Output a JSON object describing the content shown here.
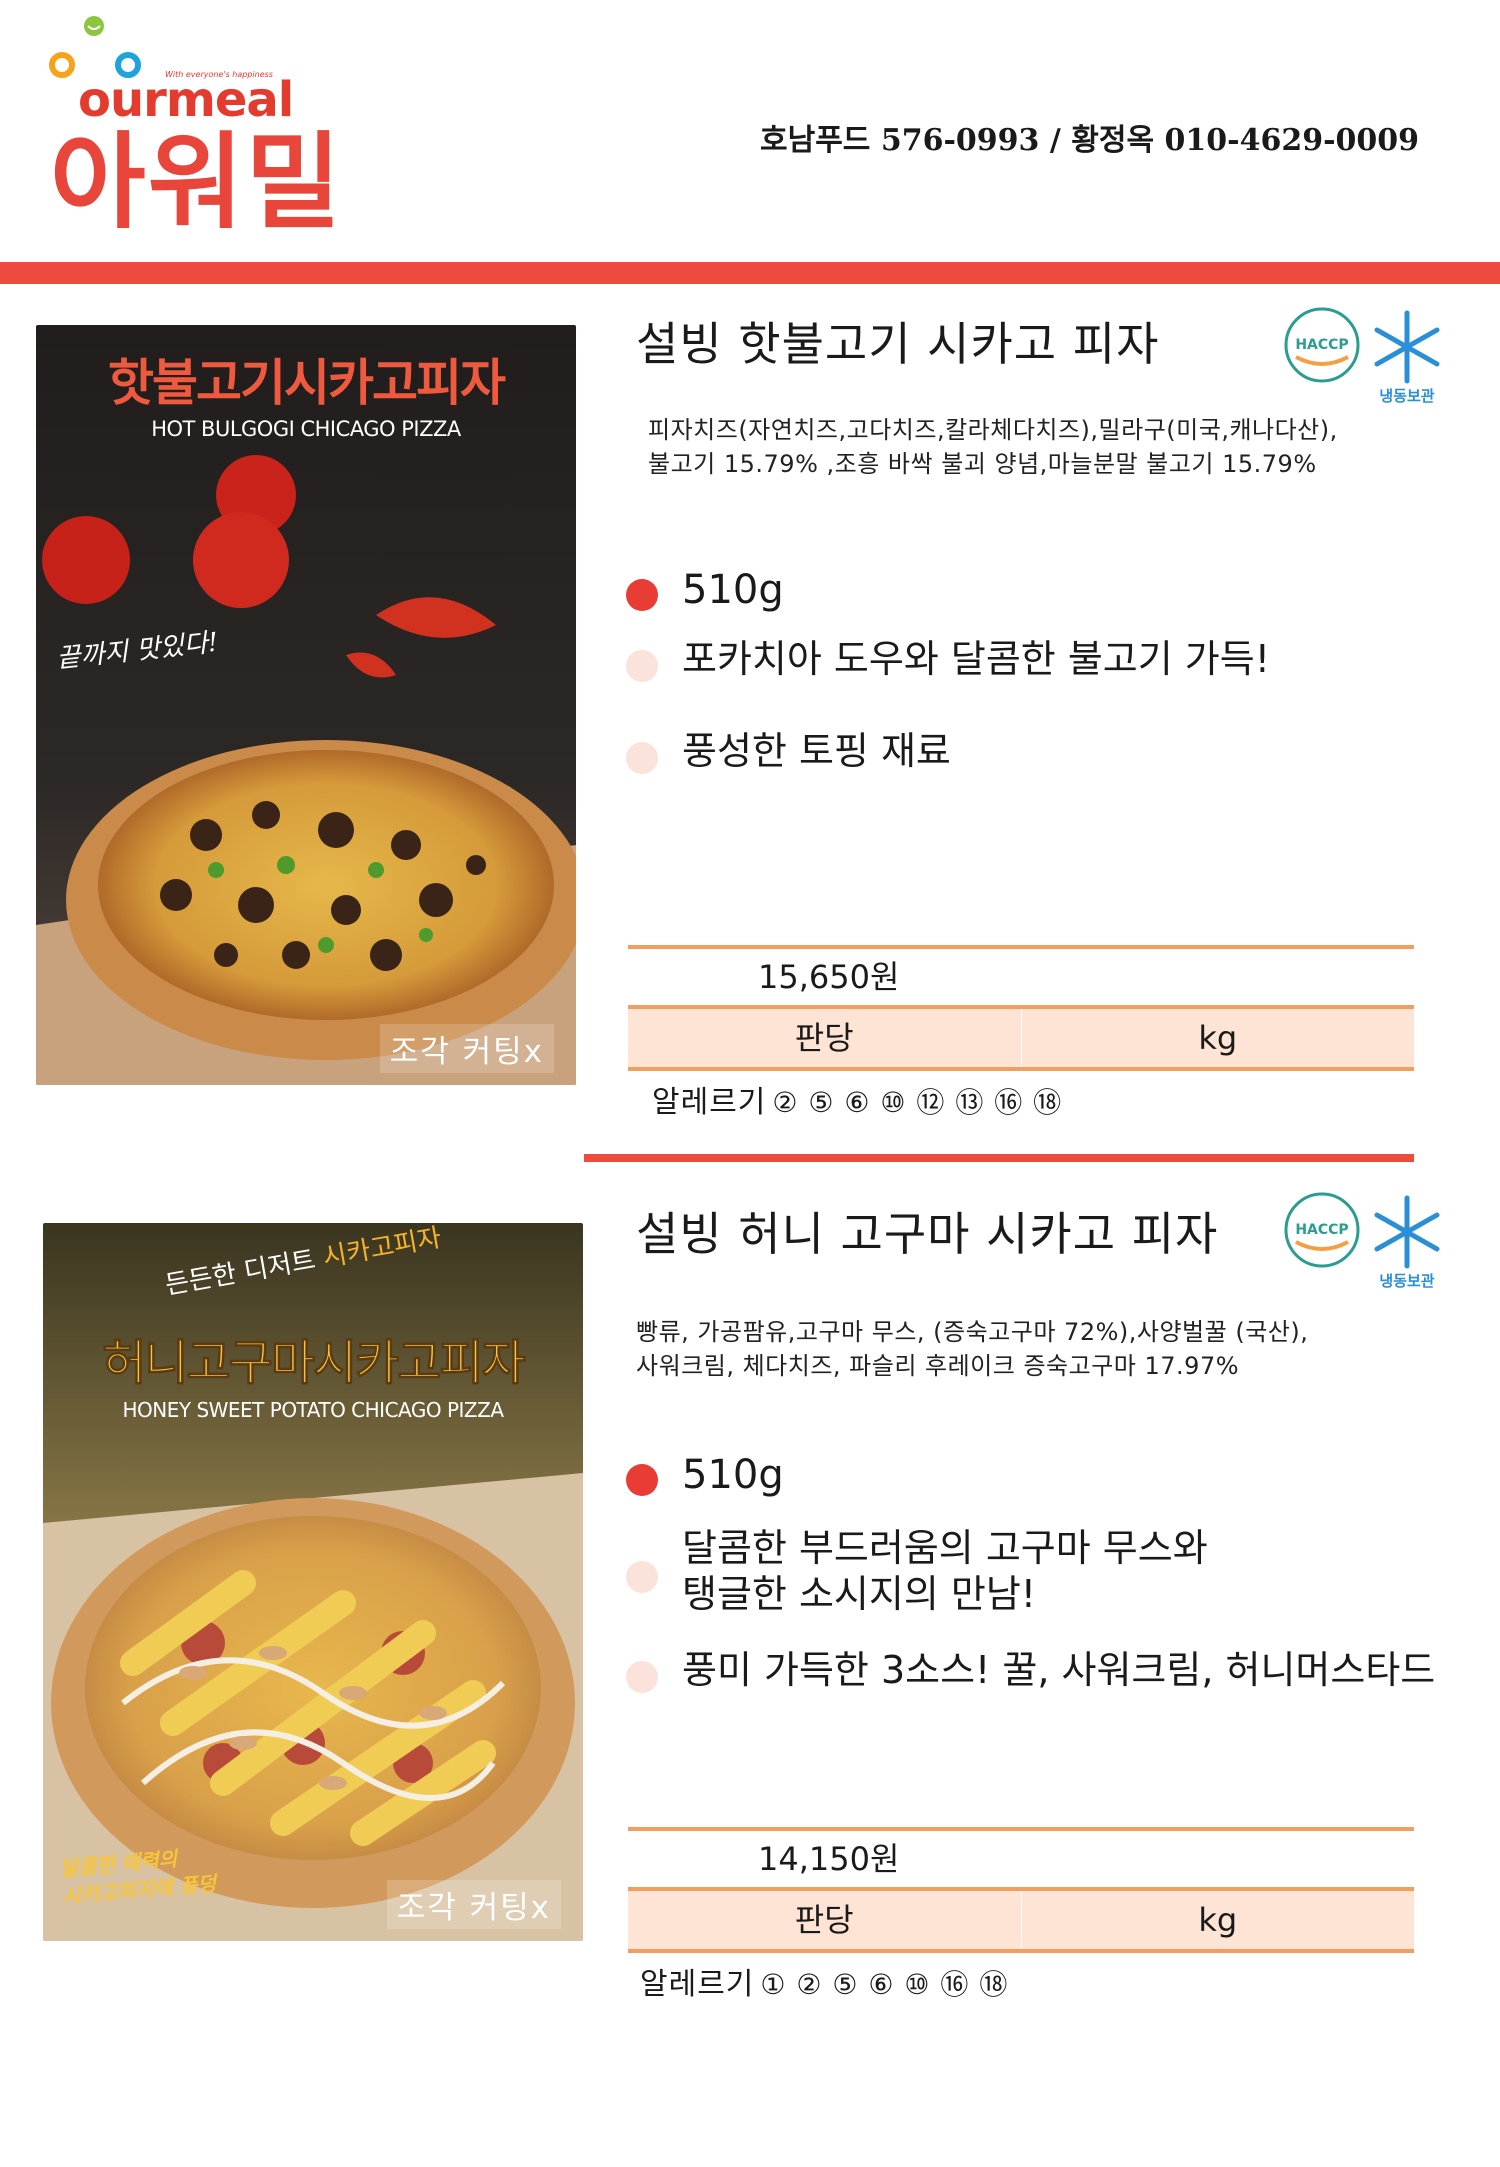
{
  "header": {
    "brand_tagline": "With everyone's happiness",
    "brand_en": "ourmeal",
    "brand_ko": "아워밀",
    "contact": "호남푸드 576-0993 / 황정옥 010-4629-0009",
    "accent_color": "#ee4a3f"
  },
  "badges": {
    "haccp_label": "HACCP",
    "frozen_label": "냉동보관"
  },
  "products": [
    {
      "photo_title": "핫불고기시카고피자",
      "photo_subtitle": "HOT BULGOGI CHICAGO PIZZA",
      "photo_script": "끝까지 맛있다!",
      "cut_label": "조각 커팅x",
      "name": "설빙 핫불고기 시카고 피자",
      "ingredients_line1": "피자치즈(자연치즈,고다치즈,칼라체다치즈),밀라구(미국,캐나다산),",
      "ingredients_line2": "불고기 15.79% ,조흥 바싹 불괴 양념,마늘분말 불고기 15.79%",
      "weight": "510g",
      "points": [
        "포카치아 도우와 달콤한 불고기 가득!",
        "풍성한 토핑 재료"
      ],
      "price": "15,650원",
      "unit_left": "판당",
      "unit_right": "kg",
      "allergy_label": "알레르기",
      "allergy_numbers": "② ⑤ ⑥ ⑩ ⑫ ⑬ ⑯ ⑱"
    },
    {
      "photo_title_prefix": "든든한 디저트",
      "photo_title_accent": "시카고피자",
      "photo_title": "허니고구마시카고피자",
      "photo_subtitle": "HONEY SWEET POTATO CHICAGO PIZZA",
      "photo_script_line1": "달콤한 매력의",
      "photo_script_line2": "시카고피자에 풍덩",
      "cut_label": "조각 커팅x",
      "name": "설빙 허니 고구마 시카고 피자",
      "ingredients_line1": "빵류, 가공팜유,고구마 무스, (증숙고구마 72%),사양벌꿀 (국산),",
      "ingredients_line2": "사워크림, 체다치즈, 파슬리 후레이크 증숙고구마 17.97%",
      "weight": "510g",
      "points": [
        "달콤한 부드러움의 고구마 무스와",
        "탱글한 소시지의 만남!",
        "풍미 가득한 3소스! 꿀, 사워크림, 허니머스타드"
      ],
      "price": "14,150원",
      "unit_left": "판당",
      "unit_right": "kg",
      "allergy_label": "알레르기",
      "allergy_numbers": "① ② ⑤ ⑥ ⑩ ⑯ ⑱"
    }
  ]
}
